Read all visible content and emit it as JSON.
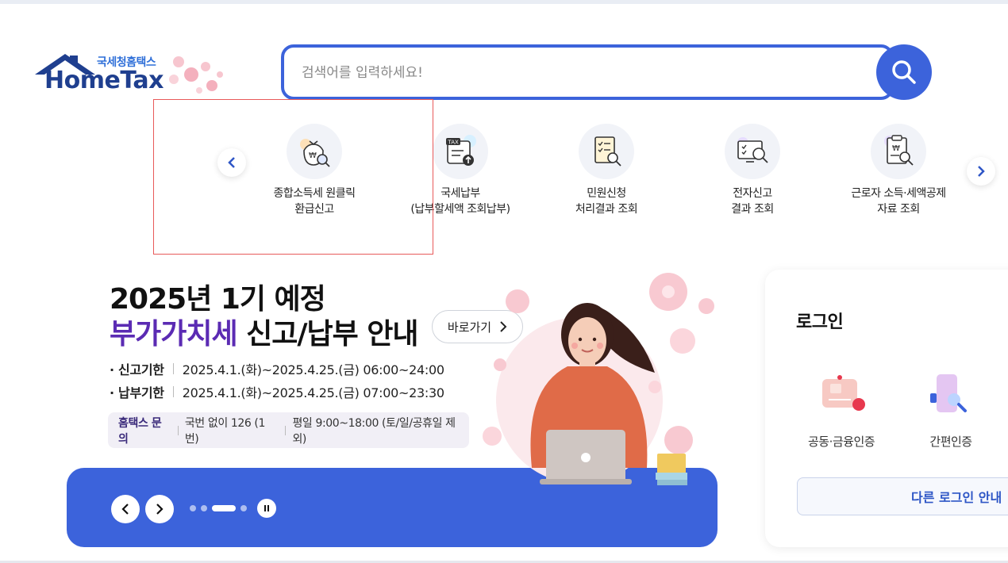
{
  "logo": {
    "sub": "국세청홈택스",
    "main": "HomeTax"
  },
  "search": {
    "placeholder": "검색어를 입력하세요!"
  },
  "quick_menu": [
    {
      "label": "종합소득세 원클릭\n환급신고",
      "icon": "money-bag-search-icon"
    },
    {
      "label": "국세납부\n(납부할세액 조회납부)",
      "icon": "tax-payment-icon"
    },
    {
      "label": "민원신청\n처리결과 조회",
      "icon": "checklist-search-icon"
    },
    {
      "label": "전자신고\n결과 조회",
      "icon": "monitor-search-icon"
    },
    {
      "label": "근로자 소득·세액공제\n자료 조회",
      "icon": "receipt-search-icon"
    }
  ],
  "banner": {
    "title_line1": "2025년 1기 예정",
    "title_accent": "부가가치세",
    "title_rest": " 신고/납부 안내",
    "goto_label": "바로가기",
    "periods": [
      {
        "label": "· 신고기한",
        "value": "2025.4.1.(화)~2025.4.25.(금) 06:00~24:00"
      },
      {
        "label": "· 납부기한",
        "value": "2025.4.1.(화)~2025.4.25.(금) 07:00~23:30"
      }
    ],
    "contact": {
      "label": "홈택스 문의",
      "phone": "국번 없이 126 (1번)",
      "hours": "평일 9:00~18:00 (토/일/공휴일 제외)"
    },
    "slide_index": 3,
    "slide_count": 4
  },
  "login": {
    "title": "로그인",
    "options": [
      {
        "label": "공동·금융인증",
        "icon": "certificate-card-icon"
      },
      {
        "label": "간편인증",
        "icon": "phone-auth-icon"
      }
    ],
    "other_label": "다른 로그인 안내"
  },
  "colors": {
    "primary": "#3c63db",
    "accent_purple": "#5b2bb3",
    "highlight": "#e85a5a"
  }
}
